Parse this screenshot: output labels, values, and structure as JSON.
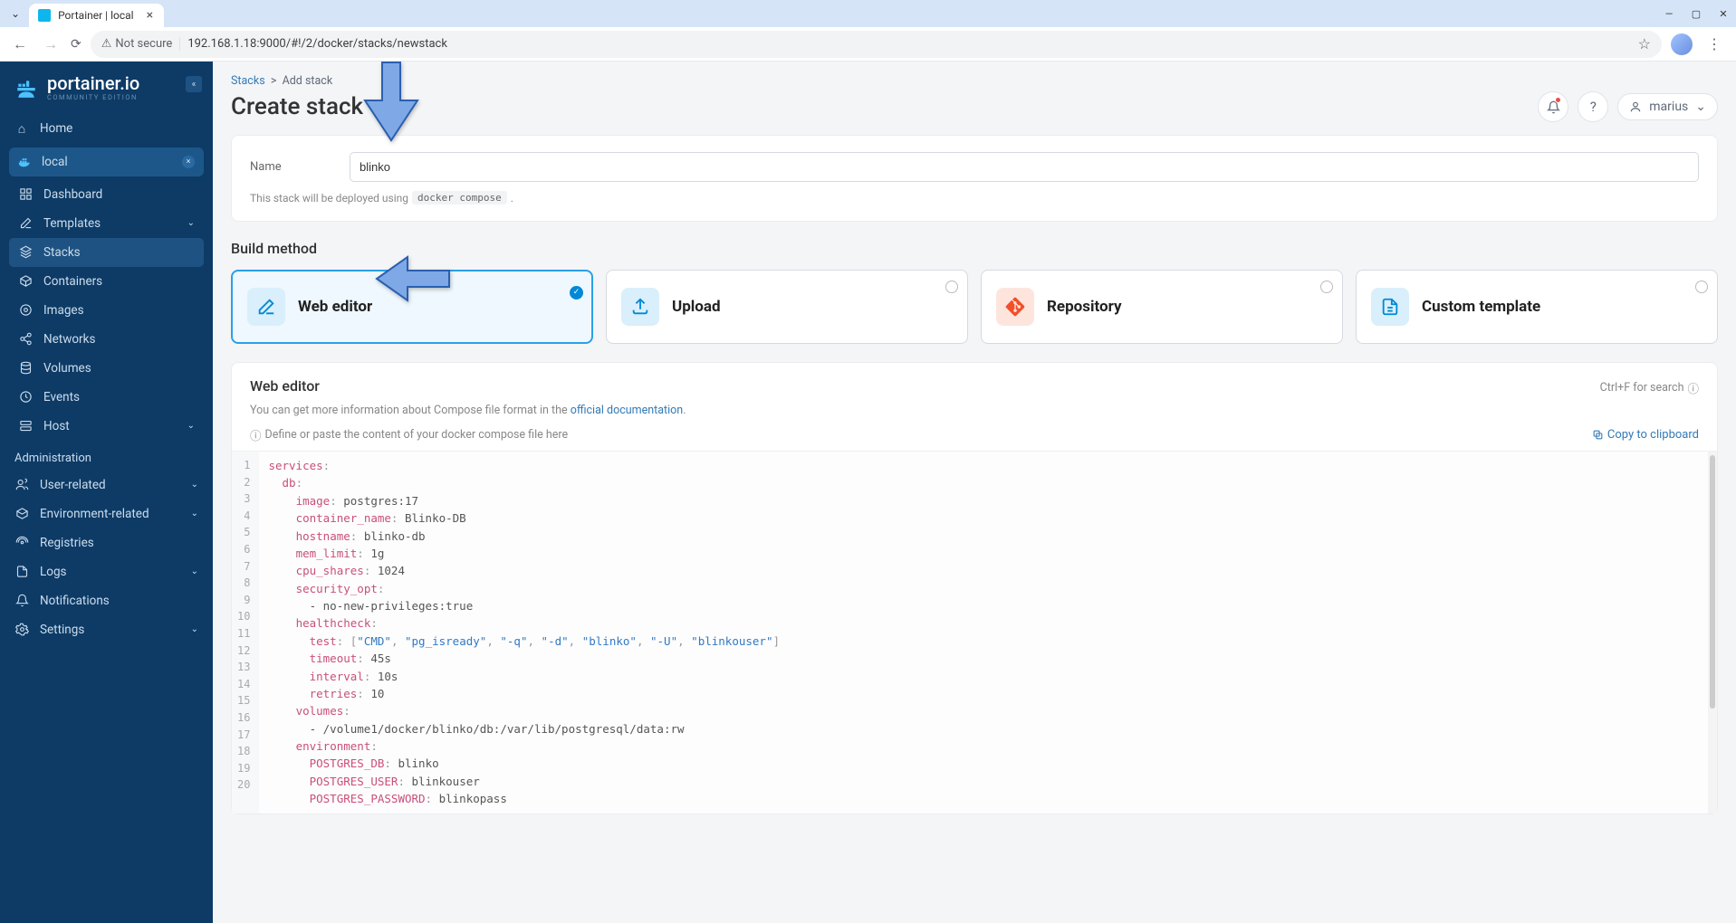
{
  "browser": {
    "tab_title": "Portainer | local",
    "secure_label": "Not secure",
    "url": "192.168.1.18:9000/#!/2/docker/stacks/newstack"
  },
  "logo": {
    "main": "portainer.io",
    "sub": "COMMUNITY EDITION"
  },
  "sidebar": {
    "home": "Home",
    "env_name": "local",
    "items": [
      {
        "label": "Dashboard",
        "icon": "grid"
      },
      {
        "label": "Templates",
        "icon": "edit",
        "chevron": true
      },
      {
        "label": "Stacks",
        "icon": "layers",
        "active": true
      },
      {
        "label": "Containers",
        "icon": "box"
      },
      {
        "label": "Images",
        "icon": "disc"
      },
      {
        "label": "Networks",
        "icon": "share"
      },
      {
        "label": "Volumes",
        "icon": "database"
      },
      {
        "label": "Events",
        "icon": "clock"
      },
      {
        "label": "Host",
        "icon": "server",
        "chevron": true
      }
    ],
    "admin_label": "Administration",
    "admin_items": [
      {
        "label": "User-related",
        "icon": "users",
        "chevron": true
      },
      {
        "label": "Environment-related",
        "icon": "cube",
        "chevron": true
      },
      {
        "label": "Registries",
        "icon": "radio"
      },
      {
        "label": "Logs",
        "icon": "file",
        "chevron": true
      },
      {
        "label": "Notifications",
        "icon": "bell"
      },
      {
        "label": "Settings",
        "icon": "gear",
        "chevron": true
      }
    ]
  },
  "breadcrumb": {
    "root": "Stacks",
    "current": "Add stack"
  },
  "page_title": "Create stack",
  "header_user": "marius",
  "form": {
    "name_label": "Name",
    "name_value": "blinko",
    "deploy_prefix": "This stack will be deployed using",
    "deploy_code": "docker compose"
  },
  "build_method": {
    "heading": "Build method",
    "options": [
      {
        "label": "Web editor",
        "icon": "edit",
        "color": "#0089d6",
        "bg": "#d9effb",
        "selected": true
      },
      {
        "label": "Upload",
        "icon": "upload",
        "color": "#0089d6",
        "bg": "#d9effb"
      },
      {
        "label": "Repository",
        "icon": "git",
        "color": "#f34f29",
        "bg": "#fde5de"
      },
      {
        "label": "Custom template",
        "icon": "file",
        "color": "#0089d6",
        "bg": "#d9effb"
      }
    ]
  },
  "editor": {
    "title": "Web editor",
    "search_hint": "Ctrl+F for search",
    "desc_prefix": "You can get more information about Compose file format in the ",
    "desc_link": "official documentation",
    "hint": "Define or paste the content of your docker compose file here",
    "copy": "Copy to clipboard"
  },
  "code_lines": [
    [
      [
        "key",
        "services"
      ],
      [
        "punc",
        ":"
      ]
    ],
    [
      [
        "plain",
        "  "
      ],
      [
        "key",
        "db"
      ],
      [
        "punc",
        ":"
      ]
    ],
    [
      [
        "plain",
        "    "
      ],
      [
        "key",
        "image"
      ],
      [
        "punc",
        ":"
      ],
      [
        "plain",
        " postgres:17"
      ]
    ],
    [
      [
        "plain",
        "    "
      ],
      [
        "key",
        "container_name"
      ],
      [
        "punc",
        ":"
      ],
      [
        "plain",
        " Blinko-DB"
      ]
    ],
    [
      [
        "plain",
        "    "
      ],
      [
        "key",
        "hostname"
      ],
      [
        "punc",
        ":"
      ],
      [
        "plain",
        " blinko-db"
      ]
    ],
    [
      [
        "plain",
        "    "
      ],
      [
        "key",
        "mem_limit"
      ],
      [
        "punc",
        ":"
      ],
      [
        "plain",
        " 1g"
      ]
    ],
    [
      [
        "plain",
        "    "
      ],
      [
        "key",
        "cpu_shares"
      ],
      [
        "punc",
        ":"
      ],
      [
        "plain",
        " 1024"
      ]
    ],
    [
      [
        "plain",
        "    "
      ],
      [
        "key",
        "security_opt"
      ],
      [
        "punc",
        ":"
      ]
    ],
    [
      [
        "plain",
        "      - no-new-privileges:true"
      ]
    ],
    [
      [
        "plain",
        "    "
      ],
      [
        "key",
        "healthcheck"
      ],
      [
        "punc",
        ":"
      ]
    ],
    [
      [
        "plain",
        "      "
      ],
      [
        "key",
        "test"
      ],
      [
        "punc",
        ": ["
      ],
      [
        "str",
        "\"CMD\""
      ],
      [
        "punc",
        ", "
      ],
      [
        "str",
        "\"pg_isready\""
      ],
      [
        "punc",
        ", "
      ],
      [
        "str",
        "\"-q\""
      ],
      [
        "punc",
        ", "
      ],
      [
        "str",
        "\"-d\""
      ],
      [
        "punc",
        ", "
      ],
      [
        "str",
        "\"blinko\""
      ],
      [
        "punc",
        ", "
      ],
      [
        "str",
        "\"-U\""
      ],
      [
        "punc",
        ", "
      ],
      [
        "str",
        "\"blinkouser\""
      ],
      [
        "punc",
        "]"
      ]
    ],
    [
      [
        "plain",
        "      "
      ],
      [
        "key",
        "timeout"
      ],
      [
        "punc",
        ":"
      ],
      [
        "plain",
        " 45s"
      ]
    ],
    [
      [
        "plain",
        "      "
      ],
      [
        "key",
        "interval"
      ],
      [
        "punc",
        ":"
      ],
      [
        "plain",
        " 10s"
      ]
    ],
    [
      [
        "plain",
        "      "
      ],
      [
        "key",
        "retries"
      ],
      [
        "punc",
        ":"
      ],
      [
        "plain",
        " 10"
      ]
    ],
    [
      [
        "plain",
        "    "
      ],
      [
        "key",
        "volumes"
      ],
      [
        "punc",
        ":"
      ]
    ],
    [
      [
        "plain",
        "      - /volume1/docker/blinko/db:/var/lib/postgresql/data:rw"
      ]
    ],
    [
      [
        "plain",
        "    "
      ],
      [
        "key",
        "environment"
      ],
      [
        "punc",
        ":"
      ]
    ],
    [
      [
        "plain",
        "      "
      ],
      [
        "key",
        "POSTGRES_DB"
      ],
      [
        "punc",
        ":"
      ],
      [
        "plain",
        " blinko"
      ]
    ],
    [
      [
        "plain",
        "      "
      ],
      [
        "key",
        "POSTGRES_USER"
      ],
      [
        "punc",
        ":"
      ],
      [
        "plain",
        " blinkouser"
      ]
    ],
    [
      [
        "plain",
        "      "
      ],
      [
        "key",
        "POSTGRES_PASSWORD"
      ],
      [
        "punc",
        ":"
      ],
      [
        "plain",
        " blinkopass"
      ]
    ]
  ]
}
